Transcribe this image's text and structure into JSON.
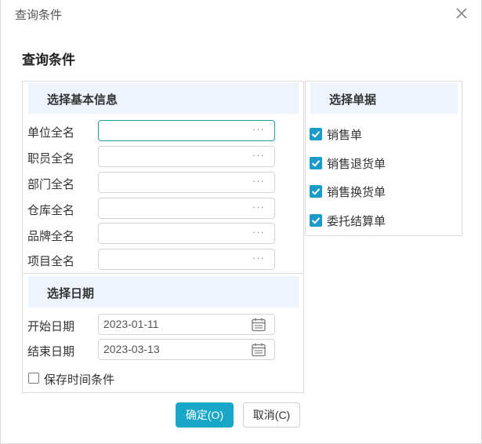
{
  "dialog": {
    "title": "查询条件",
    "heading": "查询条件"
  },
  "basic": {
    "section_title": "选择基本信息",
    "fields": [
      {
        "label": "单位全名",
        "value": "",
        "button": "···"
      },
      {
        "label": "职员全名",
        "value": "",
        "button": "···"
      },
      {
        "label": "部门全名",
        "value": "",
        "button": "···"
      },
      {
        "label": "仓库全名",
        "value": "",
        "button": "···"
      },
      {
        "label": "品牌全名",
        "value": "",
        "button": "···"
      },
      {
        "label": "项目全名",
        "value": "",
        "button": "···"
      }
    ]
  },
  "documents": {
    "section_title": "选择单据",
    "items": [
      {
        "label": "销售单",
        "checked": true
      },
      {
        "label": "销售退货单",
        "checked": true
      },
      {
        "label": "销售换货单",
        "checked": true
      },
      {
        "label": "委托结算单",
        "checked": true
      }
    ]
  },
  "dates": {
    "section_title": "选择日期",
    "start_label": "开始日期",
    "start_value": "2023-01-11",
    "end_label": "结束日期",
    "end_value": "2023-03-13",
    "save_label": "保存时间条件",
    "save_checked": false
  },
  "buttons": {
    "ok": "确定(O)",
    "cancel": "取消(C)"
  },
  "colors": {
    "accent": "#18a6c9",
    "section_bg": "#eef3fc",
    "checkbox": "#1a9bc9"
  },
  "icons": {
    "close": "close-icon",
    "calendar": "calendar-icon",
    "ellipsis": "ellipsis-icon",
    "check": "check-icon"
  }
}
